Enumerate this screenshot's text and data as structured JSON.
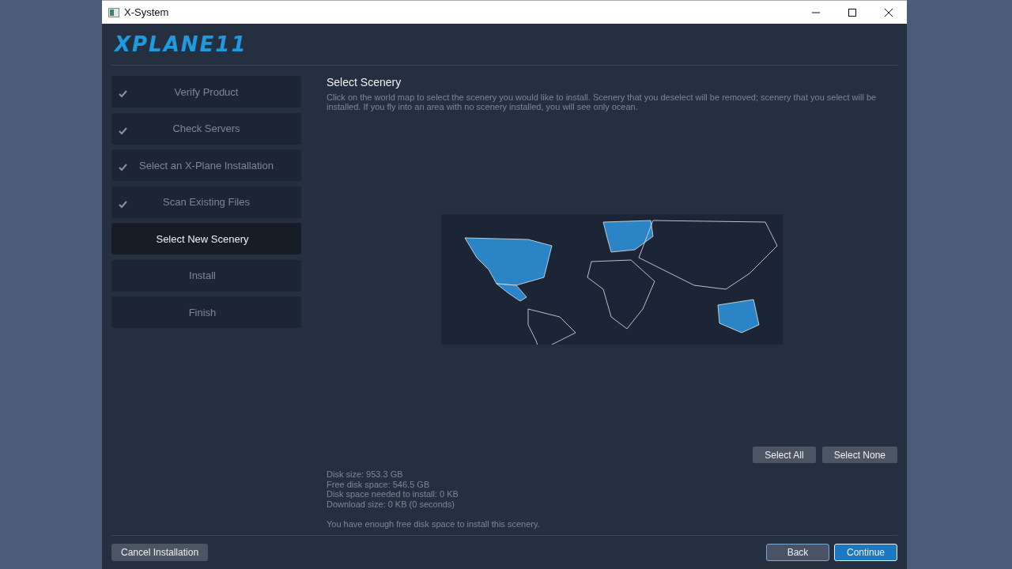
{
  "window": {
    "title": "X-System"
  },
  "logo": "XPLANE11",
  "steps": [
    {
      "label": "Verify Product",
      "checked": true,
      "selected": false
    },
    {
      "label": "Check Servers",
      "checked": true,
      "selected": false
    },
    {
      "label": "Select an X-Plane Installation",
      "checked": true,
      "selected": false
    },
    {
      "label": "Scan Existing Files",
      "checked": true,
      "selected": false
    },
    {
      "label": "Select New Scenery",
      "checked": false,
      "selected": true
    },
    {
      "label": "Install",
      "checked": false,
      "selected": false
    },
    {
      "label": "Finish",
      "checked": false,
      "selected": false
    }
  ],
  "main": {
    "title": "Select Scenery",
    "description": "Click on the world map to select the scenery you would like to install. Scenery that you deselect will be removed; scenery that you select will be installed. If you fly into an area with no scenery installed, you will see only ocean."
  },
  "map_regions": [
    {
      "kind": "north-america",
      "selected": true
    },
    {
      "kind": "central-america",
      "selected": true
    },
    {
      "kind": "south-america",
      "selected": false
    },
    {
      "kind": "europe",
      "selected": true
    },
    {
      "kind": "africa",
      "selected": false
    },
    {
      "kind": "asia",
      "selected": false
    },
    {
      "kind": "australia",
      "selected": true
    }
  ],
  "selection_buttons": [
    "Select All",
    "Select None"
  ],
  "disk_info": [
    "Disk size: 953.3 GB",
    "Free disk space: 546.5 GB",
    "Disk space needed to install: 0 KB",
    "Download size: 0 KB (0 seconds)"
  ],
  "status_message": "You have enough free disk space to install this scenery.",
  "footer": {
    "cancel": "Cancel Installation",
    "back": "Back",
    "continue": "Continue"
  }
}
